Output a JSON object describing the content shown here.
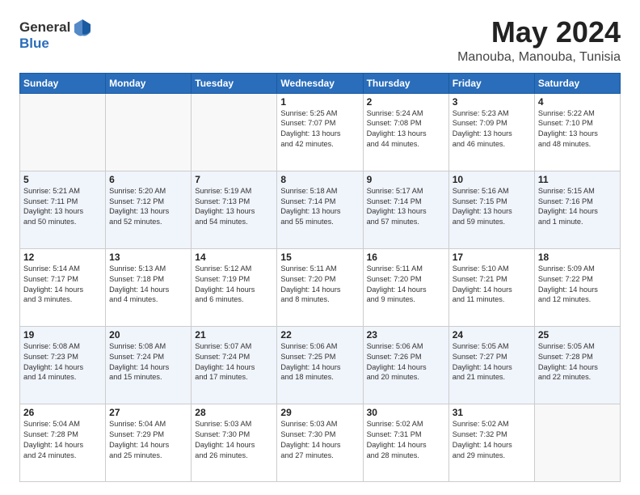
{
  "logo": {
    "general": "General",
    "blue": "Blue"
  },
  "title": "May 2024",
  "location": "Manouba, Manouba, Tunisia",
  "headers": [
    "Sunday",
    "Monday",
    "Tuesday",
    "Wednesday",
    "Thursday",
    "Friday",
    "Saturday"
  ],
  "weeks": [
    [
      {
        "day": "",
        "info": ""
      },
      {
        "day": "",
        "info": ""
      },
      {
        "day": "",
        "info": ""
      },
      {
        "day": "1",
        "info": "Sunrise: 5:25 AM\nSunset: 7:07 PM\nDaylight: 13 hours\nand 42 minutes."
      },
      {
        "day": "2",
        "info": "Sunrise: 5:24 AM\nSunset: 7:08 PM\nDaylight: 13 hours\nand 44 minutes."
      },
      {
        "day": "3",
        "info": "Sunrise: 5:23 AM\nSunset: 7:09 PM\nDaylight: 13 hours\nand 46 minutes."
      },
      {
        "day": "4",
        "info": "Sunrise: 5:22 AM\nSunset: 7:10 PM\nDaylight: 13 hours\nand 48 minutes."
      }
    ],
    [
      {
        "day": "5",
        "info": "Sunrise: 5:21 AM\nSunset: 7:11 PM\nDaylight: 13 hours\nand 50 minutes."
      },
      {
        "day": "6",
        "info": "Sunrise: 5:20 AM\nSunset: 7:12 PM\nDaylight: 13 hours\nand 52 minutes."
      },
      {
        "day": "7",
        "info": "Sunrise: 5:19 AM\nSunset: 7:13 PM\nDaylight: 13 hours\nand 54 minutes."
      },
      {
        "day": "8",
        "info": "Sunrise: 5:18 AM\nSunset: 7:14 PM\nDaylight: 13 hours\nand 55 minutes."
      },
      {
        "day": "9",
        "info": "Sunrise: 5:17 AM\nSunset: 7:14 PM\nDaylight: 13 hours\nand 57 minutes."
      },
      {
        "day": "10",
        "info": "Sunrise: 5:16 AM\nSunset: 7:15 PM\nDaylight: 13 hours\nand 59 minutes."
      },
      {
        "day": "11",
        "info": "Sunrise: 5:15 AM\nSunset: 7:16 PM\nDaylight: 14 hours\nand 1 minute."
      }
    ],
    [
      {
        "day": "12",
        "info": "Sunrise: 5:14 AM\nSunset: 7:17 PM\nDaylight: 14 hours\nand 3 minutes."
      },
      {
        "day": "13",
        "info": "Sunrise: 5:13 AM\nSunset: 7:18 PM\nDaylight: 14 hours\nand 4 minutes."
      },
      {
        "day": "14",
        "info": "Sunrise: 5:12 AM\nSunset: 7:19 PM\nDaylight: 14 hours\nand 6 minutes."
      },
      {
        "day": "15",
        "info": "Sunrise: 5:11 AM\nSunset: 7:20 PM\nDaylight: 14 hours\nand 8 minutes."
      },
      {
        "day": "16",
        "info": "Sunrise: 5:11 AM\nSunset: 7:20 PM\nDaylight: 14 hours\nand 9 minutes."
      },
      {
        "day": "17",
        "info": "Sunrise: 5:10 AM\nSunset: 7:21 PM\nDaylight: 14 hours\nand 11 minutes."
      },
      {
        "day": "18",
        "info": "Sunrise: 5:09 AM\nSunset: 7:22 PM\nDaylight: 14 hours\nand 12 minutes."
      }
    ],
    [
      {
        "day": "19",
        "info": "Sunrise: 5:08 AM\nSunset: 7:23 PM\nDaylight: 14 hours\nand 14 minutes."
      },
      {
        "day": "20",
        "info": "Sunrise: 5:08 AM\nSunset: 7:24 PM\nDaylight: 14 hours\nand 15 minutes."
      },
      {
        "day": "21",
        "info": "Sunrise: 5:07 AM\nSunset: 7:24 PM\nDaylight: 14 hours\nand 17 minutes."
      },
      {
        "day": "22",
        "info": "Sunrise: 5:06 AM\nSunset: 7:25 PM\nDaylight: 14 hours\nand 18 minutes."
      },
      {
        "day": "23",
        "info": "Sunrise: 5:06 AM\nSunset: 7:26 PM\nDaylight: 14 hours\nand 20 minutes."
      },
      {
        "day": "24",
        "info": "Sunrise: 5:05 AM\nSunset: 7:27 PM\nDaylight: 14 hours\nand 21 minutes."
      },
      {
        "day": "25",
        "info": "Sunrise: 5:05 AM\nSunset: 7:28 PM\nDaylight: 14 hours\nand 22 minutes."
      }
    ],
    [
      {
        "day": "26",
        "info": "Sunrise: 5:04 AM\nSunset: 7:28 PM\nDaylight: 14 hours\nand 24 minutes."
      },
      {
        "day": "27",
        "info": "Sunrise: 5:04 AM\nSunset: 7:29 PM\nDaylight: 14 hours\nand 25 minutes."
      },
      {
        "day": "28",
        "info": "Sunrise: 5:03 AM\nSunset: 7:30 PM\nDaylight: 14 hours\nand 26 minutes."
      },
      {
        "day": "29",
        "info": "Sunrise: 5:03 AM\nSunset: 7:30 PM\nDaylight: 14 hours\nand 27 minutes."
      },
      {
        "day": "30",
        "info": "Sunrise: 5:02 AM\nSunset: 7:31 PM\nDaylight: 14 hours\nand 28 minutes."
      },
      {
        "day": "31",
        "info": "Sunrise: 5:02 AM\nSunset: 7:32 PM\nDaylight: 14 hours\nand 29 minutes."
      },
      {
        "day": "",
        "info": ""
      }
    ]
  ]
}
